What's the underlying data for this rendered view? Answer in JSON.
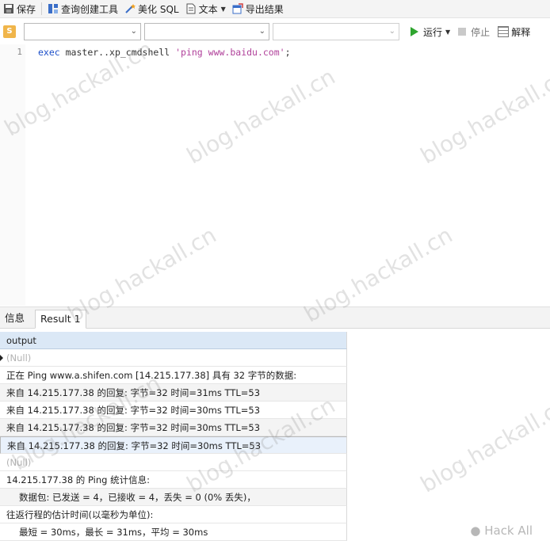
{
  "toolbar": {
    "save": "保存",
    "query_builder": "查询创建工具",
    "beautify": "美化 SQL",
    "text": "文本",
    "export": "导出结果"
  },
  "connection_bar": {
    "run": "运行",
    "stop": "停止",
    "explain": "解释"
  },
  "editor": {
    "line_number": "1",
    "code_keyword": "exec",
    "code_mid": " master..xp_cmdshell ",
    "code_string": "'ping www.baidu.com'",
    "code_end": ";"
  },
  "tabs": [
    "信息",
    "Result 1"
  ],
  "result": {
    "header": "output",
    "rows": [
      "(Null)",
      "正在 Ping www.a.shifen.com [14.215.177.38] 具有 32 字节的数据:",
      "来自 14.215.177.38 的回复: 字节=32 时间=31ms TTL=53",
      "来自 14.215.177.38 的回复: 字节=32 时间=30ms TTL=53",
      "来自 14.215.177.38 的回复: 字节=32 时间=30ms TTL=53",
      "来自 14.215.177.38 的回复: 字节=32 时间=30ms TTL=53",
      "(Null)",
      "14.215.177.38 的 Ping 统计信息:",
      "数据包: 已发送 = 4，已接收 = 4，丢失 = 0 (0% 丢失)，",
      "往返行程的估计时间(以毫秒为单位):",
      "最短 = 30ms，最长 = 31ms，平均 = 30ms"
    ]
  },
  "watermark": "blog.hackall.cn",
  "brand": "Hack All",
  "colors": {
    "header_bg": "#dbe8f6",
    "run_green": "#2fa52f",
    "keyword": "#1c4fc9",
    "string": "#b0409a"
  }
}
